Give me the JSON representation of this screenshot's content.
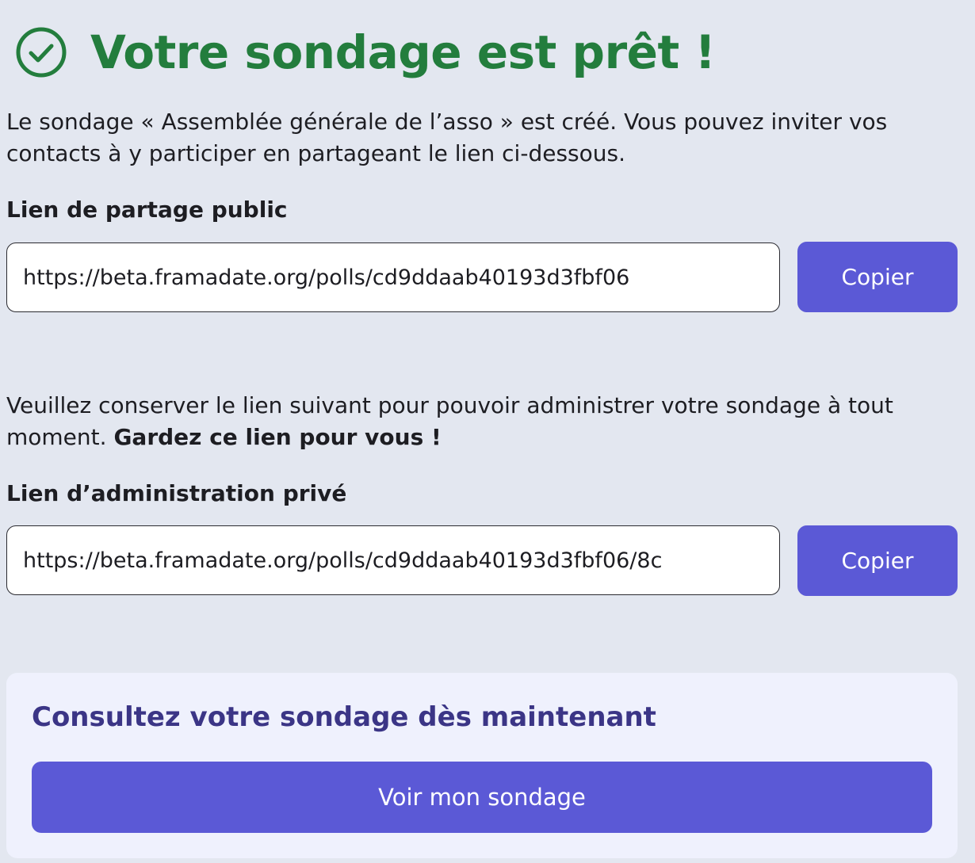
{
  "header": {
    "icon": "check-circle-icon",
    "title": "Votre sondage est prêt !",
    "color": "#237d3d"
  },
  "intro": {
    "text": "Le sondage « Assemblée générale de l’asso » est créé. Vous pouvez inviter vos contacts à y participer en partageant le lien ci-dessous."
  },
  "public_link": {
    "label": "Lien de partage public",
    "value": "https://beta.framadate.org/polls/cd9ddaab40193d3fbf06",
    "copy_label": "Copier"
  },
  "admin_notice": {
    "text": "Veuillez conserver le lien suivant pour pouvoir administrer votre sondage à tout moment. ",
    "emphasis": "Gardez ce lien pour vous !"
  },
  "admin_link": {
    "label": "Lien d’administration privé",
    "value": "https://beta.framadate.org/polls/cd9ddaab40193d3fbf06/8c",
    "copy_label": "Copier"
  },
  "cta": {
    "title": "Consultez votre sondage dès maintenant",
    "button_label": "Voir mon sondage"
  },
  "colors": {
    "accent": "#5b59d6",
    "background": "#e3e7f0",
    "card": "#eff1fd",
    "card_title": "#3b3586"
  }
}
